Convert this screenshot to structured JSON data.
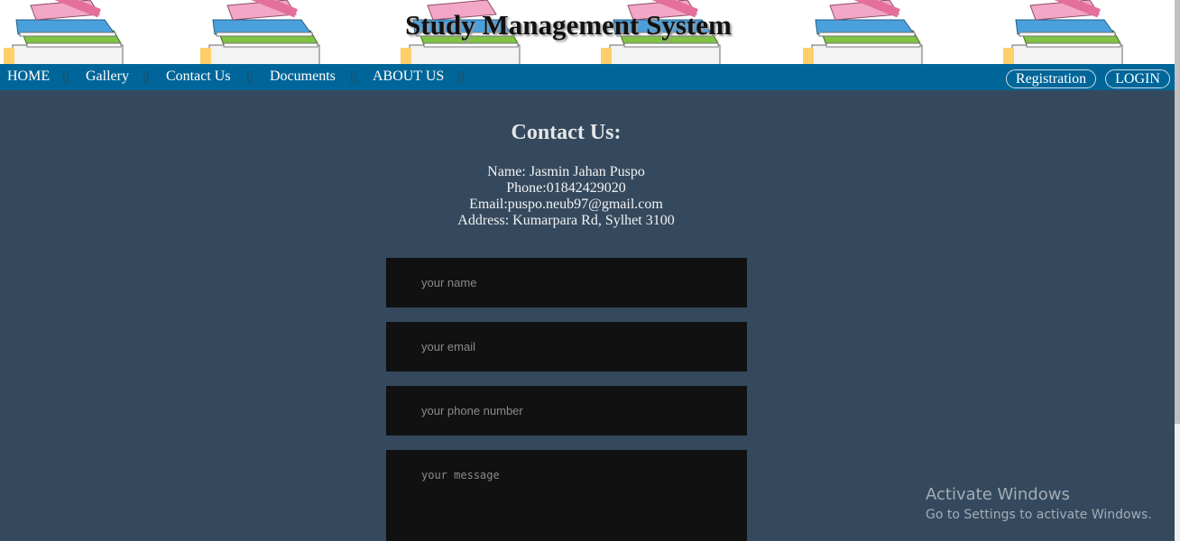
{
  "header": {
    "title": "Study Management System",
    "banner_icon": "book-stack-icon"
  },
  "nav": {
    "items": [
      "HOME",
      "Gallery",
      "Contact Us",
      "Documents",
      "ABOUT US"
    ],
    "separator": "||",
    "registration_label": "Registration",
    "login_label": "LOGIN"
  },
  "contact": {
    "heading": "Contact Us:",
    "name_line": "Name: Jasmin Jahan Puspo",
    "phone_line": "Phone:01842429020",
    "email_line": "Email:puspo.neub97@gmail.com",
    "address_line": "Address: Kumarpara Rd, Sylhet 3100"
  },
  "form": {
    "name_placeholder": "your name",
    "email_placeholder": "your email",
    "phone_placeholder": "your phone number",
    "message_placeholder": "your message",
    "name_value": "",
    "email_value": "",
    "phone_value": "",
    "message_value": ""
  },
  "watermark": {
    "line1": "Activate Windows",
    "line2": "Go to Settings to activate Windows."
  },
  "colors": {
    "page_bg": "#34495e",
    "navbar_bg": "#006699",
    "input_bg": "#111111"
  }
}
